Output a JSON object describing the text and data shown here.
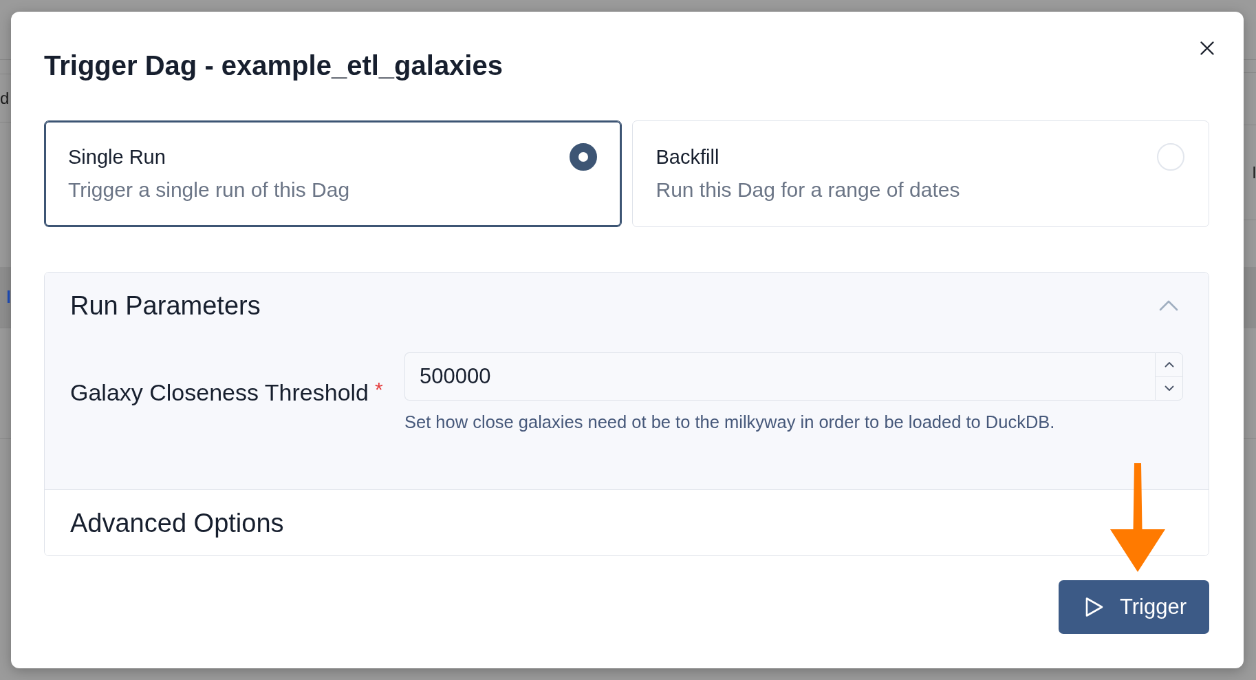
{
  "backdrop": {
    "left_edge": [
      {
        "text": "d",
        "kind": "plain"
      },
      {
        "text": "l",
        "kind": "link"
      }
    ],
    "right_edge": [
      {
        "text": "l",
        "kind": "plain"
      }
    ]
  },
  "dialog": {
    "title": "Trigger Dag - example_etl_galaxies",
    "run_modes": [
      {
        "label": "Single Run",
        "description": "Trigger a single run of this Dag",
        "selected": true
      },
      {
        "label": "Backfill",
        "description": "Run this Dag for a range of dates",
        "selected": false
      }
    ],
    "sections": [
      {
        "title": "Run Parameters",
        "expanded": true,
        "fields": [
          {
            "label": "Galaxy Closeness Threshold",
            "required_mark": "*",
            "kind": "number",
            "value": "500000",
            "help": "Set how close galaxies need ot be to the milkyway in order to be loaded to DuckDB."
          }
        ]
      },
      {
        "title": "Advanced Options",
        "expanded": false
      }
    ],
    "annotations": [
      {
        "kind": "arrow"
      }
    ],
    "buttons": [
      {
        "label": "Trigger",
        "kind": "primary"
      }
    ]
  }
}
